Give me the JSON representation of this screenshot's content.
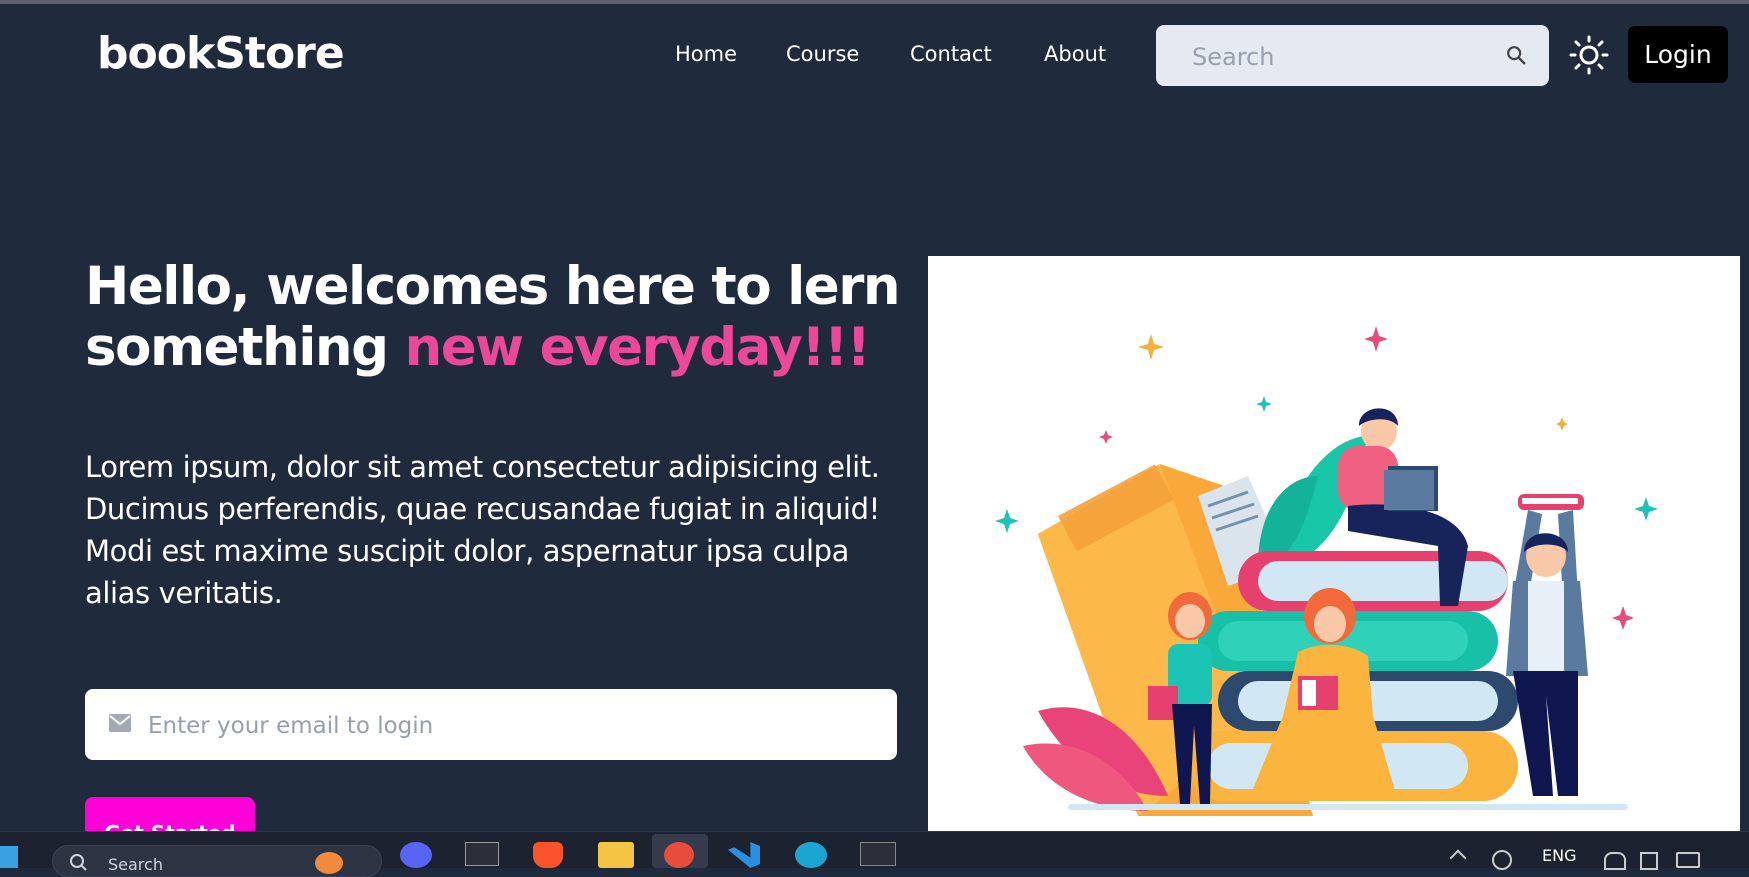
{
  "navbar": {
    "logo": "bookStore",
    "links": [
      "Home",
      "Course",
      "Contact",
      "About"
    ],
    "search_placeholder": "Search",
    "login_label": "Login"
  },
  "hero": {
    "title_part1": "Hello, welcomes here to lern something ",
    "title_accent": "new everyday!!!",
    "description": "Lorem ipsum, dolor sit amet consectetur adipisicing elit. Ducimus perferendis, quae recusandae fugiat in aliquid! Modi est maxime suscipit dolor, aspernatur ipsa culpa alias veritatis.",
    "email_placeholder": "Enter your email to login",
    "cta_label": "Get Started"
  },
  "taskbar": {
    "search_label": "Search",
    "language": "ENG"
  },
  "colors": {
    "background": "#1f2a3c",
    "accent": "#ec4899",
    "cta": "#ff00d8"
  }
}
